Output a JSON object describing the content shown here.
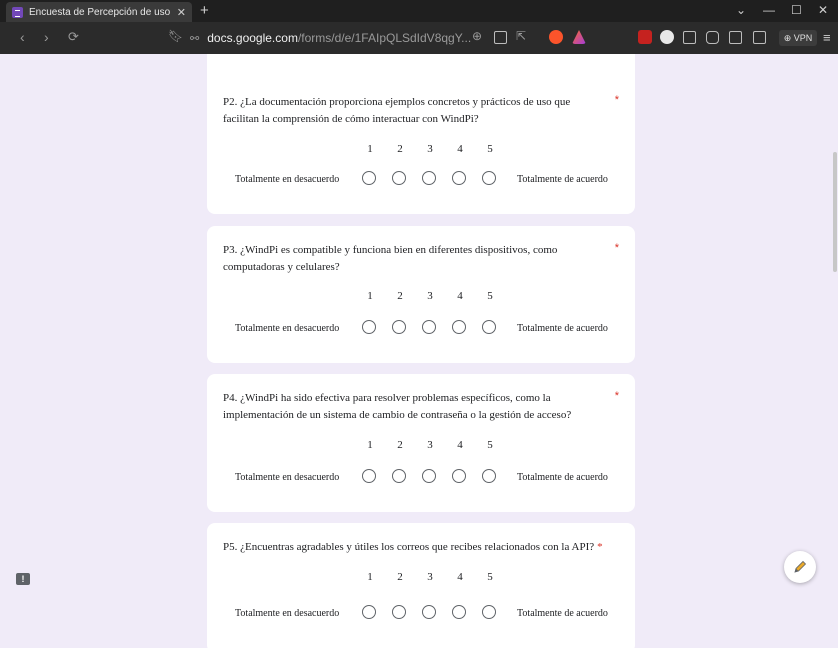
{
  "browser": {
    "tab_title": "Encuesta de Percepción de uso",
    "tab_close": "✕",
    "new_tab": "+",
    "url_domain": "docs.google.com",
    "url_path": "/forms/d/e/1FAIpQLSdIdV8qgY...",
    "vpn_label": "⊕ VPN",
    "accent_color": "#7248b9"
  },
  "questions": [
    {
      "text": "P2. ¿La documentación proporciona ejemplos concretos y prácticos de uso que facilitan la comprensión de cómo interactuar con WindPi?",
      "required": "*",
      "scale": [
        "1",
        "2",
        "3",
        "4",
        "5"
      ],
      "low_label": "Totalmente en desacuerdo",
      "high_label": "Totalmente de acuerdo"
    },
    {
      "text": "P3. ¿WindPi es compatible y funciona bien en diferentes dispositivos, como computadoras y celulares?",
      "required": "*",
      "scale": [
        "1",
        "2",
        "3",
        "4",
        "5"
      ],
      "low_label": "Totalmente en desacuerdo",
      "high_label": "Totalmente de acuerdo"
    },
    {
      "text": "P4. ¿WindPi ha sido efectiva para resolver problemas específicos, como la implementación de un sistema de cambio de contraseña o la gestión de acceso?",
      "required": "*",
      "scale": [
        "1",
        "2",
        "3",
        "4",
        "5"
      ],
      "low_label": "Totalmente en desacuerdo",
      "high_label": "Totalmente de acuerdo"
    },
    {
      "text": "P5. ¿Encuentras agradables y útiles los correos que recibes relacionados con la API?",
      "required": "*",
      "scale": [
        "1",
        "2",
        "3",
        "4",
        "5"
      ],
      "low_label": "Totalmente en desacuerdo",
      "high_label": "Totalmente de acuerdo"
    }
  ]
}
